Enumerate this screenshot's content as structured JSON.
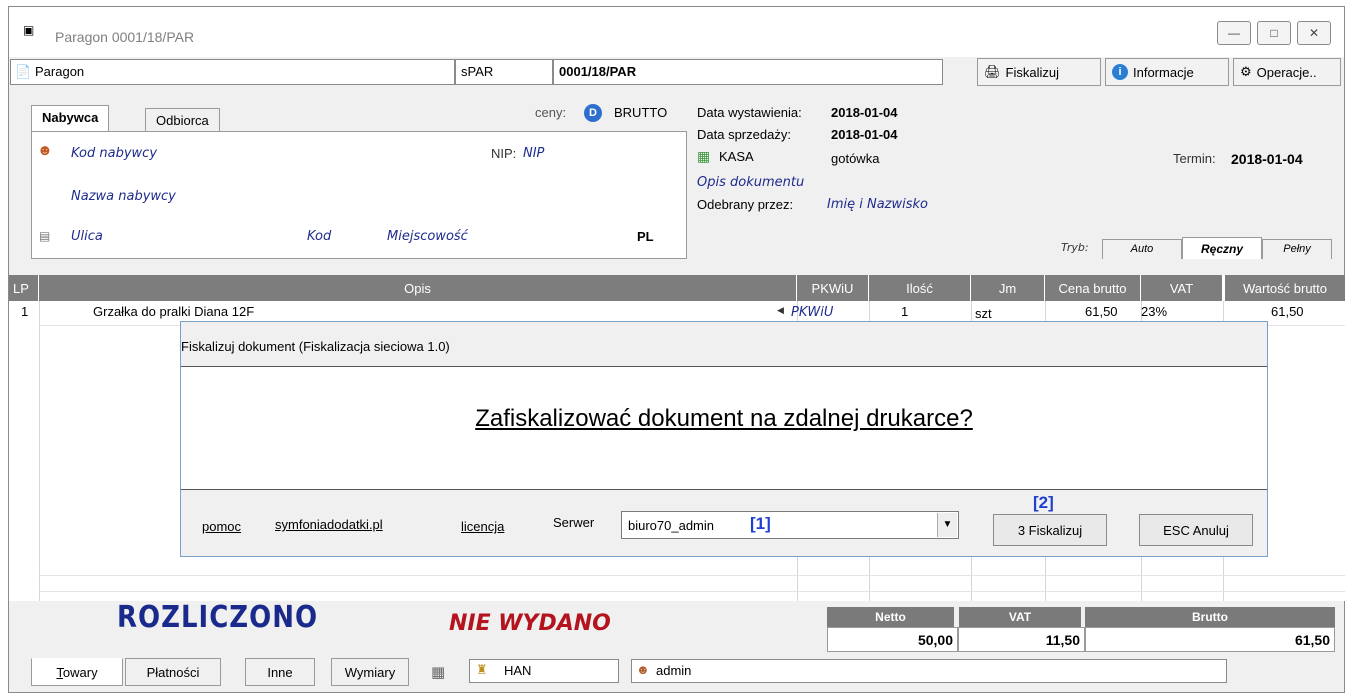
{
  "window": {
    "title": "Paragon 0001/18/PAR",
    "icon": "document-icon"
  },
  "header": {
    "doc_type": "Paragon",
    "series": "sPAR",
    "number": "0001/18/PAR",
    "buttons": {
      "fiskalizuj": "Fiskalizuj",
      "informacje": "Informacje",
      "operacje": "Operacje.."
    }
  },
  "buyer": {
    "tabs": [
      "Nabywca",
      "Odbiorca"
    ],
    "ceny_label": "ceny:",
    "ceny_badge": "D",
    "ceny_value": "BRUTTO",
    "kod": "Kod nabywcy",
    "nip_label": "NIP:",
    "nip": "NIP",
    "nazwa": "Nazwa nabywcy",
    "ulica": "Ulica",
    "kod_pocztowy": "Kod",
    "miejscowosc": "Miejscowość",
    "kraj": "PL"
  },
  "document": {
    "data_wystawienia_label": "Data wystawienia:",
    "data_wystawienia": "2018-01-04",
    "data_sprzedazy_label": "Data sprzedaży:",
    "data_sprzedazy": "2018-01-04",
    "kasa": "KASA",
    "platnosc": "gotówka",
    "termin_label": "Termin:",
    "termin": "2018-01-04",
    "opis": "Opis dokumentu",
    "odebrany_label": "Odebrany przez:",
    "odebrany": "Imię i Nazwisko",
    "tryb_label": "Tryb:",
    "tryb_tabs": [
      "Auto",
      "Ręczny",
      "Pełny"
    ]
  },
  "table": {
    "columns": [
      "LP",
      "Opis",
      "PKWiU",
      "Ilość",
      "Jm",
      "Cena brutto",
      "VAT",
      "Wartość brutto"
    ],
    "rows": [
      {
        "lp": "1",
        "opis": "Grzałka do pralki Diana 12F",
        "pkwiu": "PKWiU",
        "ilosc": "1",
        "jm": "szt",
        "cena": "61,50",
        "vat": "23%",
        "wartosc": "61,50"
      }
    ]
  },
  "dialog": {
    "title": "Fiskalizuj dokument (Fiskalizacja sieciowa 1.0)",
    "question": "Zafiskalizować dokument na zdalnej drukarce?",
    "links": {
      "pomoc": "pomoc",
      "site": "symfoniadodatki.pl",
      "licencja": "licencja"
    },
    "serwer_label": "Serwer",
    "serwer_value": "biuro70_admin",
    "marker1": "[1]",
    "marker2": "[2]",
    "fiskalizuj_btn": "3 Fiskalizuj",
    "anuluj_btn": "ESC Anuluj"
  },
  "footer": {
    "rozliczono": "ROZLICZONO",
    "nie_wydano": "NIE WYDANO",
    "netto_label": "Netto",
    "netto": "50,00",
    "vat_label": "VAT",
    "vat": "11,50",
    "brutto_label": "Brutto",
    "brutto": "61,50",
    "tabs": [
      "Towary",
      "Płatności",
      "Inne",
      "Wymiary"
    ],
    "magazyn": "HAN",
    "user": "admin"
  },
  "colors": {
    "stamp_blue": "#1a2a8c",
    "stamp_red": "#b3141e",
    "marker_blue": "#1f3fd1",
    "header_gray": "#7d7d7d"
  }
}
